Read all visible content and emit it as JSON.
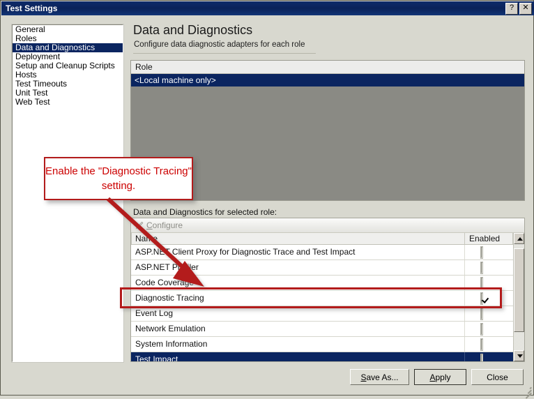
{
  "window": {
    "title": "Test Settings",
    "help_button": "?",
    "close_button": "✕"
  },
  "sidebar": {
    "items": [
      {
        "label": "General",
        "selected": false
      },
      {
        "label": "Roles",
        "selected": false
      },
      {
        "label": "Data and Diagnostics",
        "selected": true
      },
      {
        "label": "Deployment",
        "selected": false
      },
      {
        "label": "Setup and Cleanup Scripts",
        "selected": false
      },
      {
        "label": "Hosts",
        "selected": false
      },
      {
        "label": "Test Timeouts",
        "selected": false
      },
      {
        "label": "Unit Test",
        "selected": false
      },
      {
        "label": "Web Test",
        "selected": false
      }
    ]
  },
  "pane": {
    "title": "Data and Diagnostics",
    "subtitle": "Configure data diagnostic adapters for each role"
  },
  "role_grid": {
    "header": "Role",
    "rows": [
      {
        "label": "<Local machine only>",
        "selected": true
      }
    ]
  },
  "adapters": {
    "section_label": "Data and Diagnostics for selected role:",
    "configure_button": "Configure",
    "configure_accelerator": "C",
    "columns": [
      "Name",
      "Enabled"
    ],
    "rows": [
      {
        "name": "ASP.NET Client Proxy for Diagnostic Trace and Test Impact",
        "enabled": false,
        "selected": false
      },
      {
        "name": "ASP.NET Profiler",
        "enabled": false,
        "selected": false
      },
      {
        "name": "Code Coverage",
        "enabled": false,
        "selected": false
      },
      {
        "name": "Diagnostic Tracing",
        "enabled": true,
        "selected": false
      },
      {
        "name": "Event Log",
        "enabled": false,
        "selected": false
      },
      {
        "name": "Network Emulation",
        "enabled": false,
        "selected": false
      },
      {
        "name": "System Information",
        "enabled": false,
        "selected": false
      },
      {
        "name": "Test Impact",
        "enabled": false,
        "selected": true
      }
    ]
  },
  "footer": {
    "save_as": "Save As...",
    "save_as_accel": "S",
    "apply": "Apply",
    "apply_accel": "A",
    "close": "Close"
  },
  "annotation": {
    "callout_text": "Enable the \"Diagnostic Tracing\" setting.",
    "callout_color": "#cc0000",
    "border_color": "#b31b1b",
    "highlight_target": "Diagnostic Tracing"
  }
}
